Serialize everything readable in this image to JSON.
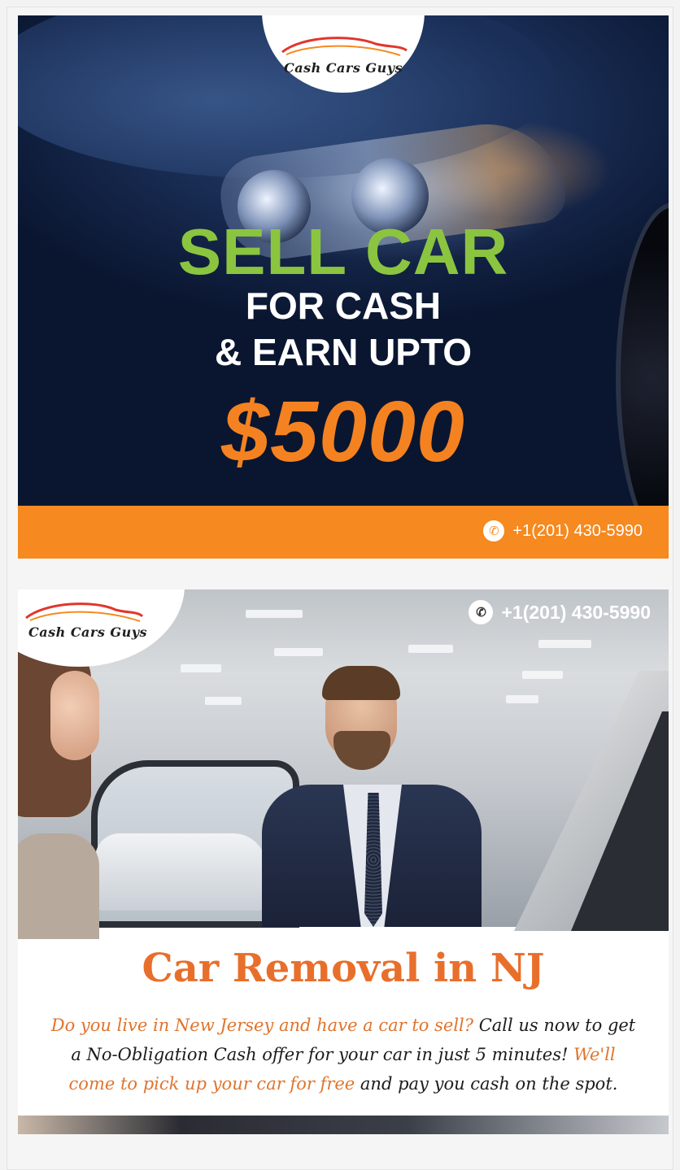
{
  "brand": {
    "name": "Cash Cars Guys"
  },
  "ad1": {
    "headline_1": "SELL CAR",
    "headline_2": "FOR CASH",
    "headline_3": "& EARN UPTO",
    "amount": "$5000",
    "phone": "+1(201) 430-5990",
    "colors": {
      "green": "#8bc540",
      "orange": "#f6891f",
      "navy": "#0b1b3a"
    }
  },
  "ad2": {
    "phone": "+1(201) 430-5990",
    "title": "Car Removal in NJ",
    "body": {
      "part1": "Do you live in New Jersey and have a car to sell?",
      "part2": " Call us now to get a No-Obligation Cash offer for your car in just 5 minutes! ",
      "part3": "We'll come to pick up your car for free",
      "part4": " and pay you cash on the spot."
    },
    "colors": {
      "title_orange": "#e86f2b",
      "highlight": "#e0742c"
    }
  },
  "icons": {
    "phone": "phone-icon"
  }
}
